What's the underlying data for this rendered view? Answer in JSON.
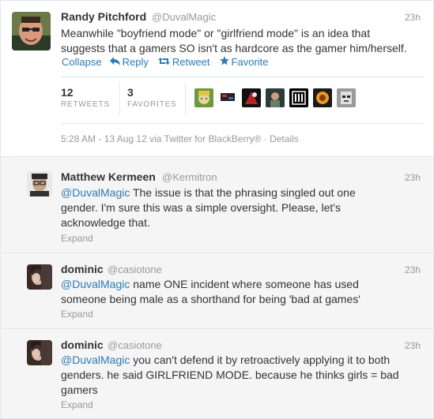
{
  "main_tweet": {
    "name": "Randy Pitchford",
    "handle": "@DuvalMagic",
    "time": "23h",
    "text_lines": [
      "Meanwhile \"boyfriend mode\" or \"girlfriend mode\" is an idea that",
      "suggests that a gamers SO isn't as hardcore as the gamer him/herself."
    ],
    "actions": {
      "collapse": "Collapse",
      "reply": "Reply",
      "retweet": "Retweet",
      "favorite": "Favorite"
    },
    "stats": {
      "retweets_count": "12",
      "retweets_label": "RETWEETS",
      "favorites_count": "3",
      "favorites_label": "FAVORITES"
    },
    "meta": "5:28 AM - 13 Aug 12 via Twitter for BlackBerry® · Details"
  },
  "replies": [
    {
      "name": "Matthew Kermeen",
      "handle": "@Kermitron",
      "time": "23h",
      "mention": "@DuvalMagic",
      "line1_rest": " The issue is that the phrasing singled out one",
      "lines": [
        "gender. I'm sure this was a simple oversight. Please, let's",
        "acknowledge that."
      ],
      "expand": "Expand"
    },
    {
      "name": "dominic",
      "handle": "@casiotone",
      "time": "23h",
      "mention": "@DuvalMagic",
      "line1_rest": " name ONE incident where someone has used",
      "lines": [
        "someone being male as a shorthand for being 'bad at games'"
      ],
      "expand": "Expand"
    },
    {
      "name": "dominic",
      "handle": "@casiotone",
      "time": "23h",
      "mention": "@DuvalMagic",
      "line1_rest": " you can't defend it by retroactively applying it to both",
      "lines": [
        "genders. he said GIRLFRIEND MODE. because he thinks girls = bad",
        "gamers"
      ],
      "expand": "Expand"
    }
  ],
  "colors": {
    "link": "#2b7bb9",
    "muted": "#999999",
    "text": "#333333",
    "reply_bg": "#f5f5f5"
  },
  "icons": {
    "reply": "reply-arrow-icon",
    "retweet": "retweet-icon",
    "favorite": "star-icon"
  }
}
